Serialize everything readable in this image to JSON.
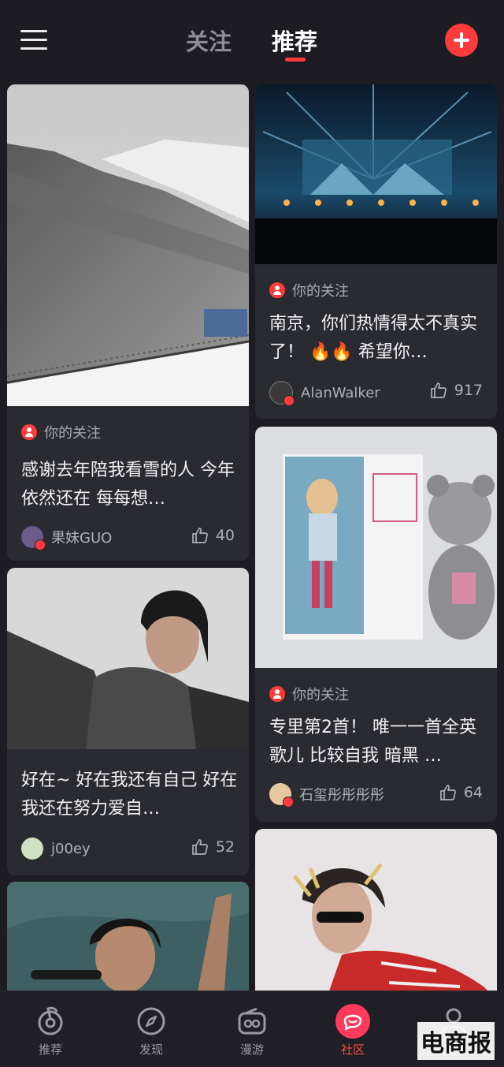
{
  "header": {
    "tabs": [
      {
        "label": "关注",
        "active": false
      },
      {
        "label": "推荐",
        "active": true
      }
    ],
    "accent_color": "#ff3a3a"
  },
  "cards": [
    {
      "title": "感谢去年陪我看雪的人 今年依然还在 每每想…",
      "follow_tag": "你的关注",
      "author": "果妹GUO",
      "likes": "40"
    },
    {
      "title": "南京，你们热情得太不真实了！ 🔥🔥 希望你…",
      "follow_tag": "你的关注",
      "author": "AlanWalker",
      "likes": "917"
    },
    {
      "title": "好在~ 好在我还有自己 好在我还在努力爱自…",
      "follow_tag": "",
      "author": "j00ey",
      "likes": "52"
    },
    {
      "title": "专里第2首！ 唯一一首全英歌儿 比较自我 暗黑 …",
      "follow_tag": "你的关注",
      "author": "石玺彤彤彤彤",
      "likes": "64"
    }
  ],
  "nav": [
    {
      "label": "推荐",
      "icon": "netease-logo-icon",
      "active": false
    },
    {
      "label": "发现",
      "icon": "compass-icon",
      "active": false
    },
    {
      "label": "漫游",
      "icon": "radio-icon",
      "active": false
    },
    {
      "label": "社区",
      "icon": "chat-bubble-icon",
      "active": true
    },
    {
      "label": "我的",
      "icon": "user-icon",
      "active": false
    }
  ],
  "watermark": "电商报"
}
